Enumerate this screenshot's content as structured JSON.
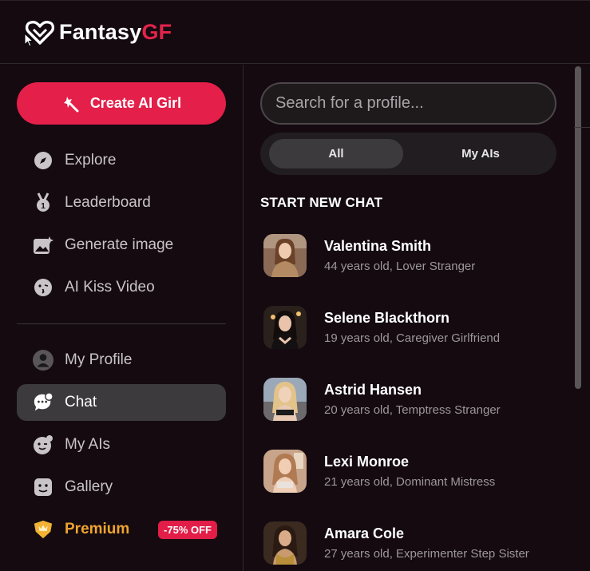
{
  "brand": {
    "name_part1": "Fantasy",
    "name_part2": "GF",
    "accent_color": "#e3234b"
  },
  "sidebar": {
    "create_button": "Create AI Girl",
    "nav_top": [
      {
        "label": "Explore",
        "icon": "compass-icon"
      },
      {
        "label": "Leaderboard",
        "icon": "medal-icon"
      },
      {
        "label": "Generate image",
        "icon": "image-sparkle-icon"
      },
      {
        "label": "AI Kiss Video",
        "icon": "kiss-face-icon"
      }
    ],
    "nav_bottom": [
      {
        "label": "My Profile",
        "icon": "user-avatar-icon"
      },
      {
        "label": "Chat",
        "icon": "chat-bubble-icon",
        "active": true
      },
      {
        "label": "My AIs",
        "icon": "wink-face-icon"
      },
      {
        "label": "Gallery",
        "icon": "gallery-face-icon"
      },
      {
        "label": "Premium",
        "icon": "crown-shield-icon"
      }
    ],
    "premium_badge": "-75% OFF"
  },
  "main": {
    "search_placeholder": "Search for a profile...",
    "tabs": [
      {
        "label": "All",
        "active": true
      },
      {
        "label": "My AIs",
        "active": false
      }
    ],
    "section_title": "START NEW CHAT",
    "chats": [
      {
        "name": "Valentina Smith",
        "desc": "44 years old, Lover Stranger"
      },
      {
        "name": "Selene Blackthorn",
        "desc": "19 years old, Caregiver Girlfriend"
      },
      {
        "name": "Astrid Hansen",
        "desc": "20 years old, Temptress Stranger"
      },
      {
        "name": "Lexi Monroe",
        "desc": "21 years old, Dominant Mistress"
      },
      {
        "name": "Amara Cole",
        "desc": "27 years old, Experimenter Step Sister"
      }
    ]
  }
}
